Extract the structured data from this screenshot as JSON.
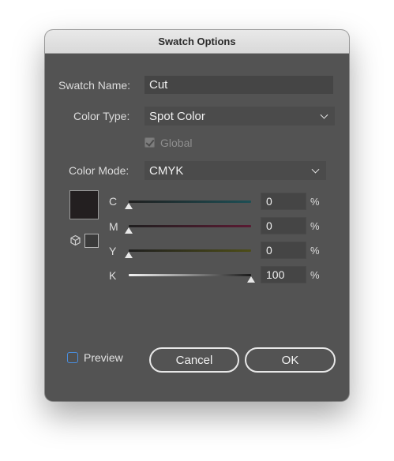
{
  "dialog": {
    "title": "Swatch Options",
    "swatch_name_label": "Swatch Name:",
    "swatch_name_value": "Cut",
    "color_type_label": "Color Type:",
    "color_type_value": "Spot Color",
    "global_label": "Global",
    "global_checked": true,
    "color_mode_label": "Color Mode:",
    "color_mode_value": "CMYK",
    "swatch_color": "#231f20",
    "channels": [
      {
        "letter": "C",
        "value": "0",
        "unit": "%",
        "track_color": "#1d4f55",
        "level": 0
      },
      {
        "letter": "M",
        "value": "0",
        "unit": "%",
        "track_color": "#5a1a32",
        "level": 0
      },
      {
        "letter": "Y",
        "value": "0",
        "unit": "%",
        "track_color": "#4d4d17",
        "level": 0
      },
      {
        "letter": "K",
        "value": "100",
        "unit": "%",
        "track_color": "#1a1a1a",
        "level": 100
      }
    ],
    "preview_label": "Preview",
    "preview_checked": false,
    "cancel_label": "Cancel",
    "ok_label": "OK"
  },
  "colors": {
    "dialog_bg": "#535353",
    "field_bg": "#454545",
    "accent_checkbox": "#4a8fe0"
  }
}
